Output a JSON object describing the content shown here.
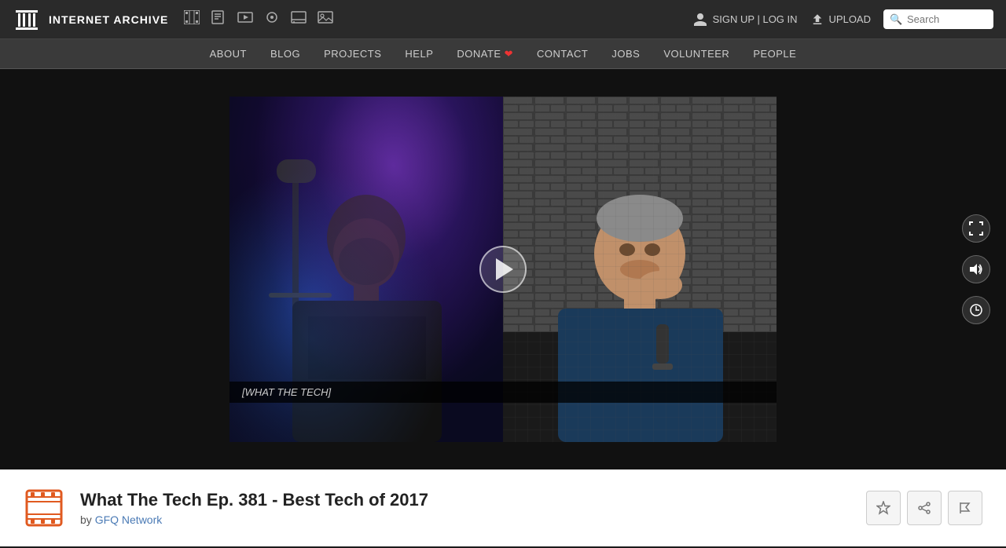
{
  "site": {
    "name": "INTERNET ARCHIVE"
  },
  "topnav": {
    "signup_text": "SIGN UP | LOG IN",
    "upload_text": "UPLOAD",
    "search_placeholder": "Search"
  },
  "secondarynav": {
    "items": [
      {
        "label": "ABOUT"
      },
      {
        "label": "BLOG"
      },
      {
        "label": "PROJECTS"
      },
      {
        "label": "HELP"
      },
      {
        "label": "DONATE"
      },
      {
        "label": "CONTACT"
      },
      {
        "label": "JOBS"
      },
      {
        "label": "VOLUNTEER"
      },
      {
        "label": "PEOPLE"
      }
    ]
  },
  "video": {
    "subtitle": "[WHAT THE TECH]",
    "play_label": "Play"
  },
  "item": {
    "title": "What The Tech Ep. 381 - Best Tech of 2017",
    "author_prefix": "by",
    "author": "GFQ Network",
    "icon_color": "#e05a20"
  },
  "actions": {
    "favorite_label": "Favorite",
    "share_label": "Share",
    "flag_label": "Flag"
  },
  "icons": {
    "fullscreen": "⛶",
    "volume": "🔊",
    "clock": "🕐"
  }
}
